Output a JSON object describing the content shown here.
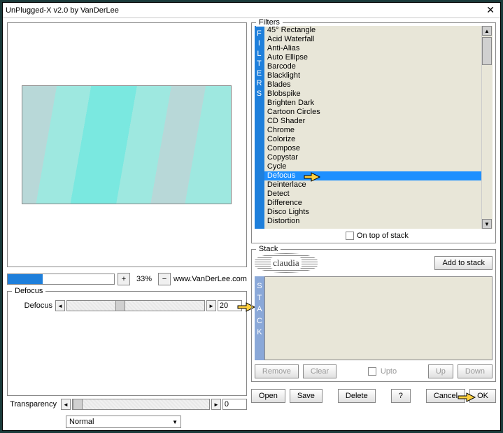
{
  "window": {
    "title": "UnPlugged-X v2.0 by VanDerLee"
  },
  "progress": {
    "percent": "33%",
    "link": "www.VanDerLee.com"
  },
  "defocus": {
    "group_label": "Defocus",
    "param_label": "Defocus",
    "value": "20"
  },
  "transparency": {
    "label": "Transparency",
    "value": "0",
    "blend_mode": "Normal"
  },
  "filters": {
    "group_label": "Filters",
    "items": [
      "45° Rectangle",
      "Acid Waterfall",
      "Anti-Alias",
      "Auto Ellipse",
      "Barcode",
      "Blacklight",
      "Blades",
      "Blobspike",
      "Brighten Dark",
      "Cartoon Circles",
      "CD Shader",
      "Chrome",
      "Colorize",
      "Compose",
      "Copystar",
      "Cycle",
      "Defocus",
      "Deinterlace",
      "Detect",
      "Difference",
      "Disco Lights",
      "Distortion"
    ],
    "selected_index": 16,
    "on_top_label": "On top of stack"
  },
  "stack": {
    "group_label": "Stack",
    "logo_text": "claudia",
    "add_button": "Add to stack",
    "buttons": {
      "remove": "Remove",
      "clear": "Clear",
      "upto": "Upto",
      "up": "Up",
      "down": "Down"
    }
  },
  "bottom": {
    "open": "Open",
    "save": "Save",
    "delete": "Delete",
    "help": "?",
    "cancel": "Cancel",
    "ok": "OK"
  }
}
